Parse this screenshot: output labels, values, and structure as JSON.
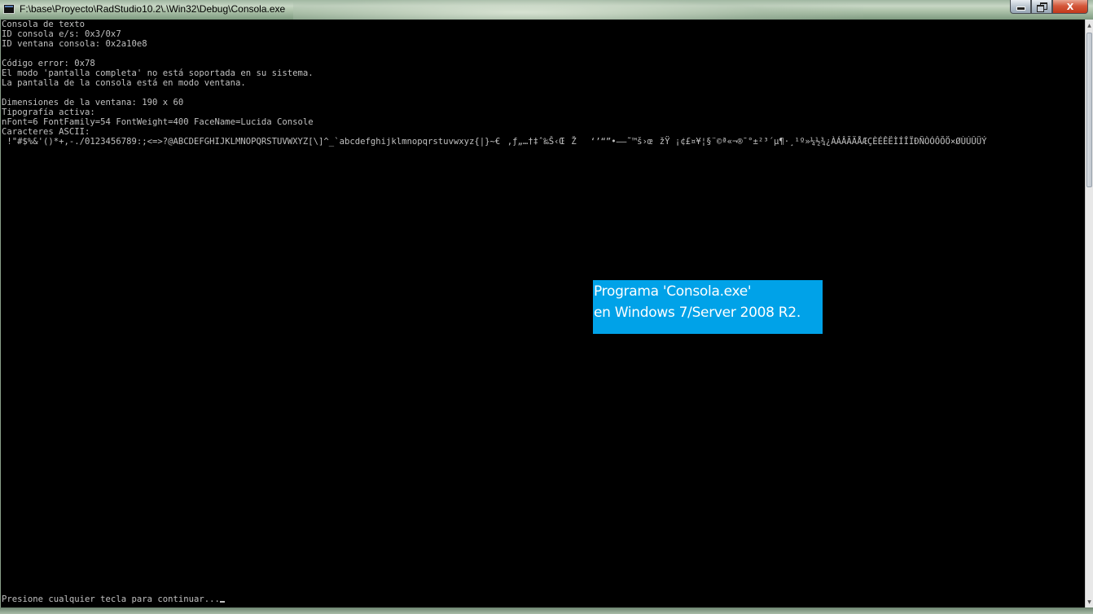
{
  "window": {
    "title": "F:\\base\\Proyecto\\RadStudio10.2\\.\\Win32\\Debug\\Consola.exe",
    "buttons": {
      "minimize_icon": "minimize-icon",
      "maximize_icon": "restore-icon",
      "close_label": "X"
    }
  },
  "console": {
    "lines": [
      "Consola de texto",
      "ID consola e/s: 0x3/0x7",
      "ID ventana consola: 0x2a10e8",
      "",
      "Código error: 0x78",
      "El modo 'pantalla completa' no está soportada en su sistema.",
      "La pantalla de la consola está en modo ventana.",
      "",
      "Dimensiones de la ventana: 190 x 60",
      "Tipografía activa:",
      "nFont=6 FontFamily=54 FontWeight=400 FaceName=Lucida Console",
      "Caracteres ASCII:",
      " !\"#$%&'()*+,-./0123456789:;<=>?@ABCDEFGHIJKLMNOPQRSTUVWXYZ[\\]^_`abcdefghijklmnopqrstuvwxyz{|}~€‚ƒ„…†‡ˆ‰Š‹ŒŽ‘’“”•–—˜™š›œžŸ ¡¢£¤¥¦§¨©ª«¬­®¯°±²³´µ¶·¸¹º»¼½¾¿ÀÁÂÃÄÅÆÇÈÉÊËÌÍÎÏÐÑÒÓÔÕÖ×ØÙÚÛÜÝ"
    ],
    "prompt": "Presione cualquier tecla para continuar..."
  },
  "annotation": {
    "line1": "Programa 'Consola.exe'",
    "line2": "en Windows 7/Server 2008 R2.",
    "color": "#00a2e8"
  },
  "colors": {
    "console_bg": "#000000",
    "console_fg": "#c0c0c0",
    "close_button": "#c7402a"
  }
}
